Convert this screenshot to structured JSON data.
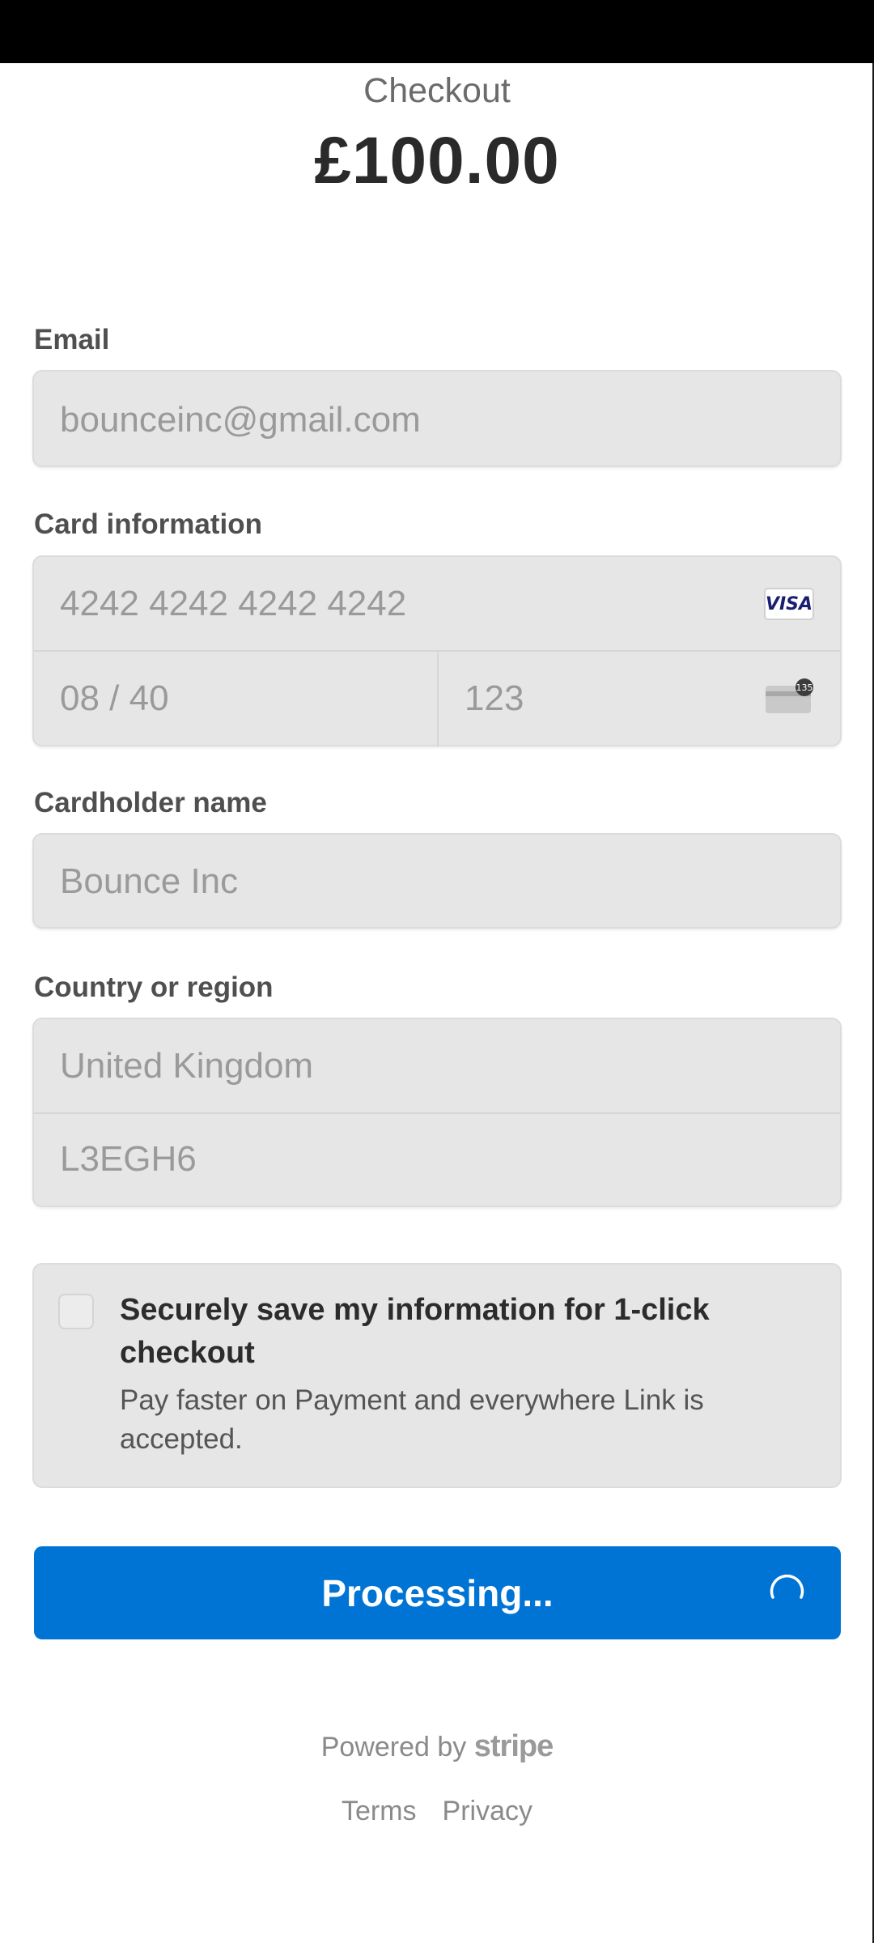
{
  "header": {
    "title": "Checkout",
    "amount": "£100.00"
  },
  "email": {
    "label": "Email",
    "value": "bounceinc@gmail.com"
  },
  "card": {
    "label": "Card information",
    "number": "4242 4242 4242 4242",
    "expiry": "08 / 40",
    "cvc": "123",
    "brand_badge": "VISA",
    "cvc_hint": "135"
  },
  "cardholder": {
    "label": "Cardholder name",
    "value": "Bounce Inc"
  },
  "country": {
    "label": "Country or region",
    "value": "United Kingdom",
    "postal": "L3EGH6"
  },
  "save_info": {
    "title": "Securely save my information for 1-click checkout",
    "description": "Pay faster on Payment and everywhere Link is accepted.",
    "checked": false
  },
  "pay_button": {
    "label": "Processing..."
  },
  "footer": {
    "powered_prefix": "Powered by",
    "brand": "stripe",
    "terms": "Terms",
    "privacy": "Privacy"
  },
  "colors": {
    "accent": "#0074d4",
    "field_bg": "#e6e6e6",
    "visa_blue": "#1a1f71"
  },
  "icons": {
    "card_brand": "visa-icon",
    "cvc": "cvc-card-icon",
    "loading": "spinner-icon"
  }
}
